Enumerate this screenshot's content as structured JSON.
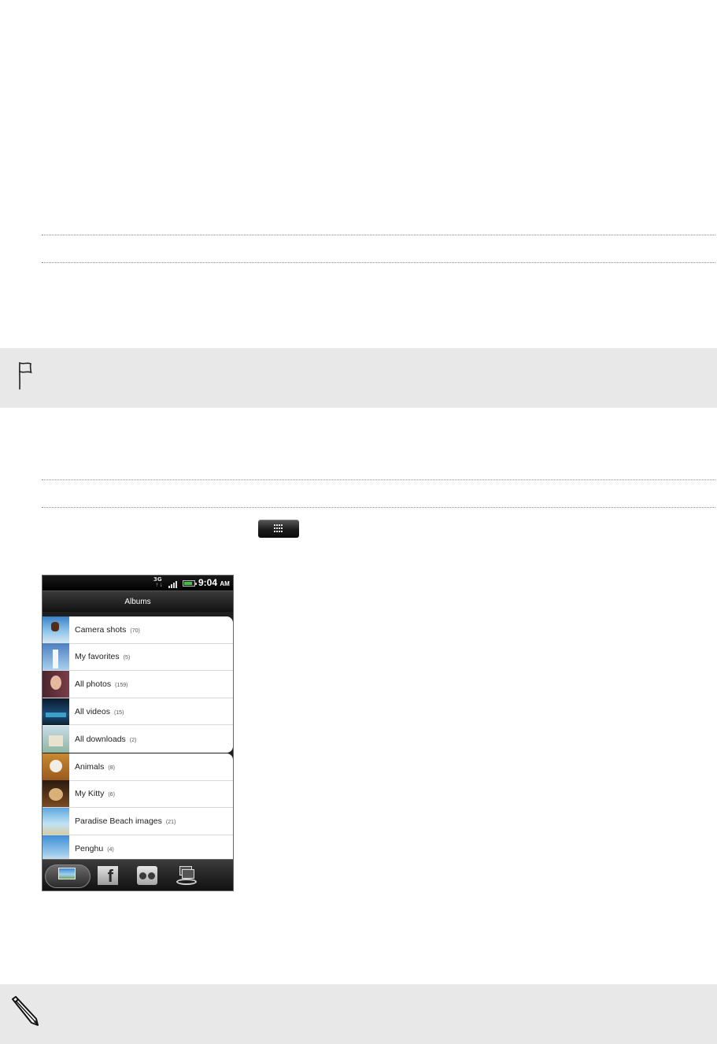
{
  "menu_key": {
    "icon": "menu-grid-icon"
  },
  "phone": {
    "status": {
      "network": "3G",
      "time": "9:04",
      "ampm": "AM",
      "battery_level": 0.85
    },
    "title": "Albums",
    "albums_group1": [
      {
        "name": "Camera shots",
        "count": "(70)",
        "thumb": "th-cam"
      },
      {
        "name": "My favorites",
        "count": "(5)",
        "thumb": "th-fav"
      },
      {
        "name": "All photos",
        "count": "(159)",
        "thumb": "th-all"
      },
      {
        "name": "All videos",
        "count": "(15)",
        "thumb": "th-vid"
      },
      {
        "name": "All downloads",
        "count": "(2)",
        "thumb": "th-dl"
      }
    ],
    "albums_group2": [
      {
        "name": "Animals",
        "count": "(8)",
        "thumb": "th-ani"
      },
      {
        "name": "My Kitty",
        "count": "(6)",
        "thumb": "th-kit"
      },
      {
        "name": "Paradise Beach images",
        "count": "(21)",
        "thumb": "th-par"
      },
      {
        "name": "Penghu",
        "count": "(4)",
        "thumb": "th-pen"
      }
    ],
    "tabs": [
      {
        "icon": "albums-icon",
        "active": true
      },
      {
        "icon": "facebook-icon",
        "active": false
      },
      {
        "icon": "flickr-icon",
        "active": false
      },
      {
        "icon": "friend-stream-icon",
        "active": false
      }
    ]
  },
  "notes": {
    "flag_icon": "flag-icon",
    "pencil_icon": "pencil-icon"
  }
}
